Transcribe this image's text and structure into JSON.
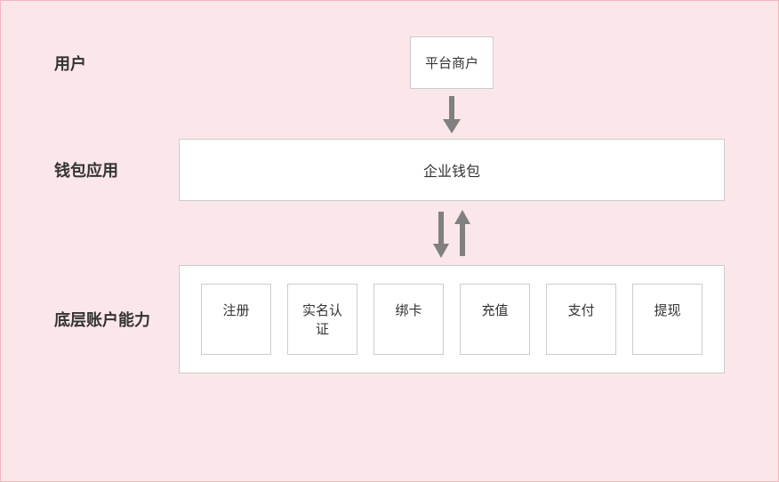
{
  "rows": {
    "user": {
      "label": "用户",
      "box": "平台商户"
    },
    "wallet": {
      "label": "钱包应用",
      "box": "企业钱包"
    },
    "account": {
      "label": "底层账户能力",
      "items": [
        "注册",
        "实名认证",
        "绑卡",
        "充值",
        "支付",
        "提现"
      ]
    }
  },
  "colors": {
    "background": "#FBE7E9",
    "border": "#F3B8BE",
    "boxBg": "#ffffff",
    "boxBorder": "#cccccc",
    "arrow": "#808080"
  }
}
